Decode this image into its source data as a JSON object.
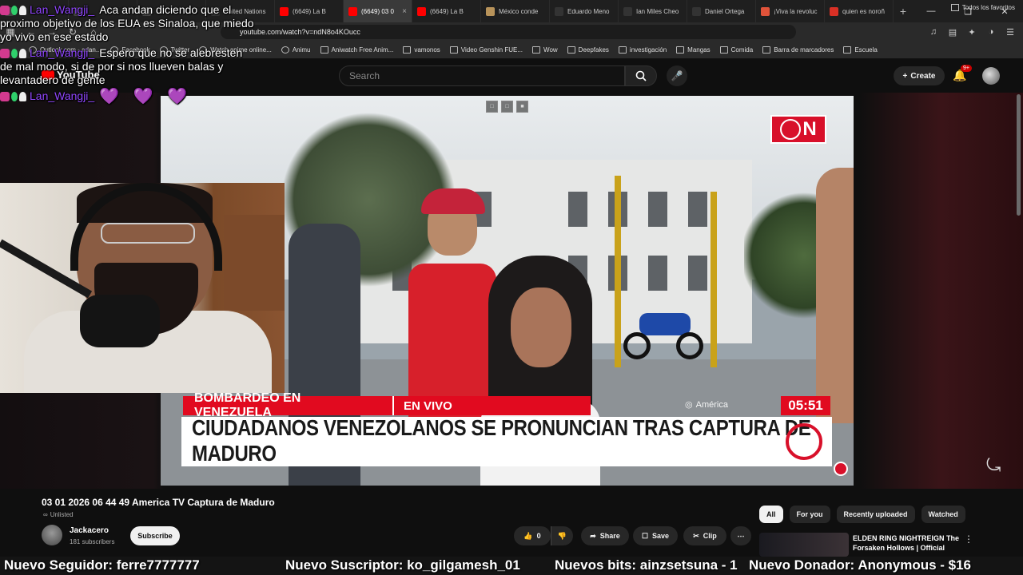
{
  "browser": {
    "tabs": [
      {
        "title": "",
        "color": "#444444",
        "active": false
      },
      {
        "title": "",
        "color": "#444444",
        "active": false
      },
      {
        "title": "",
        "color": "#444444",
        "active": false
      },
      {
        "title": "United Nations",
        "color": "#333333",
        "active": false
      },
      {
        "title": "(6649) La B",
        "color": "#ff0000",
        "active": false
      },
      {
        "title": "(6649) 03 0",
        "color": "#ff0000",
        "active": true
      },
      {
        "title": "(6649) La B",
        "color": "#ff0000",
        "active": false
      },
      {
        "title": "México conde",
        "color": "#b8935a",
        "active": false
      },
      {
        "title": "Eduardo Meno",
        "color": "#333333",
        "active": false
      },
      {
        "title": "Ian Miles Cheo",
        "color": "#333333",
        "active": false
      },
      {
        "title": "Daniel Ortega",
        "color": "#333333",
        "active": false
      },
      {
        "title": "¡Viva la revoluc",
        "color": "#e0533a",
        "active": false
      },
      {
        "title": "quien es noroñ",
        "color": "#d93025",
        "active": false
      }
    ],
    "url": "youtube.com/watch?v=ndN8o4KOucc",
    "bookmarks": [
      "Outlook.com - adan...",
      "Facebook",
      "Twitter",
      "Watch anime online...",
      "Animu",
      "Aniwatch Free Anim...",
      "vamonos",
      "Video Genshin FUE...",
      "Wow",
      "Deepfakes",
      "investigación",
      "Mangas",
      "Comida",
      "Barra de marcadores",
      "Escuela"
    ],
    "all_bookmarks": "Todos los favoritos"
  },
  "youtube": {
    "logo": "YouTube",
    "search_placeholder": "Search",
    "create_label": "Create",
    "notif_count": "9+"
  },
  "video": {
    "ctrl_icons": [
      "□",
      "□",
      "■"
    ],
    "brand": "N",
    "lower_third_tag": "BOMBARDEO EN VENEZUELA",
    "lower_third_live": "EN VIVO",
    "network": "América",
    "clock": "05:51",
    "headline": "CIUDADANOS VENEZOLANOS SE PRONUNCIAN TRAS CAPTURA DE MADURO"
  },
  "chat": [
    {
      "user": "Lan_Wangji_",
      "message": "Aca andan diciendo que el proximo objetivo de los EUA es Sinaloa, que miedo yo vivo en ese estado"
    },
    {
      "user": "Lan_Wangji_",
      "message": "Espero que no se alebresten de mal modo, si de por si nos llueven balas y levantadero de gente"
    },
    {
      "user": "Lan_Wangji_",
      "message": "💜 💜 💜"
    }
  ],
  "meta": {
    "title": "03 01 2026 06 44 49 America TV Captura de Maduro",
    "visibility": "Unlisted",
    "channel": "Jackacero",
    "subscribers": "181 subscribers",
    "subscribe_label": "Subscribe",
    "likes": "0",
    "share_label": "Share",
    "save_label": "Save",
    "clip_label": "Clip"
  },
  "chips": [
    "All",
    "For you",
    "Recently uploaded",
    "Watched"
  ],
  "recommendation": {
    "title": "ELDEN RING NIGHTREIGN The Forsaken Hollows | Official"
  },
  "alerts": [
    "Nuevo Seguidor: ferre7777777",
    "Nuevo Suscriptor: ko_gilgamesh_01",
    "Nuevos bits: ainzsetsuna - 1",
    "Nuevo Donador: Anonymous - $16"
  ]
}
